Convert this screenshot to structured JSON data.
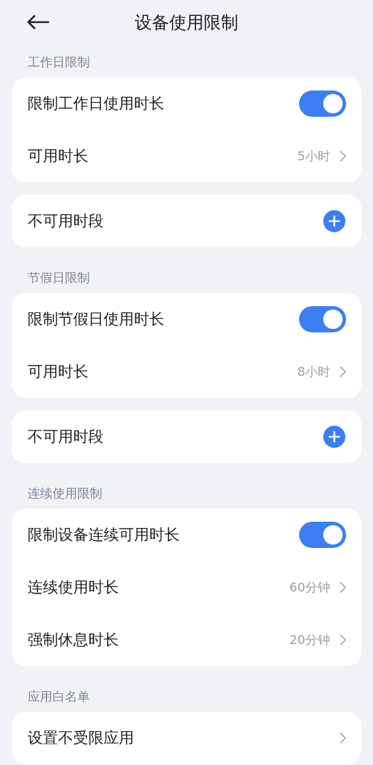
{
  "header": {
    "title": "设备使用限制"
  },
  "sections": [
    {
      "title": "工作日限制",
      "cards": [
        {
          "rows": [
            {
              "kind": "toggle",
              "label": "限制工作日使用时长",
              "on": true
            },
            {
              "kind": "value",
              "label": "可用时长",
              "value": "5小时"
            }
          ]
        },
        {
          "rows": [
            {
              "kind": "add",
              "label": "不可用时段"
            }
          ]
        }
      ]
    },
    {
      "title": "节假日限制",
      "cards": [
        {
          "rows": [
            {
              "kind": "toggle",
              "label": "限制节假日使用时长",
              "on": true
            },
            {
              "kind": "value",
              "label": "可用时长",
              "value": "8小时"
            }
          ]
        },
        {
          "rows": [
            {
              "kind": "add",
              "label": "不可用时段"
            }
          ]
        }
      ]
    },
    {
      "title": "连续使用限制",
      "cards": [
        {
          "rows": [
            {
              "kind": "toggle",
              "label": "限制设备连续可用时长",
              "on": true
            },
            {
              "kind": "value",
              "label": "连续使用时长",
              "value": "60分钟"
            },
            {
              "kind": "value",
              "label": "强制休息时长",
              "value": "20分钟"
            }
          ]
        }
      ]
    },
    {
      "title": "应用白名单",
      "cards": [
        {
          "rows": [
            {
              "kind": "link",
              "label": "设置不受限应用"
            }
          ]
        }
      ]
    }
  ]
}
